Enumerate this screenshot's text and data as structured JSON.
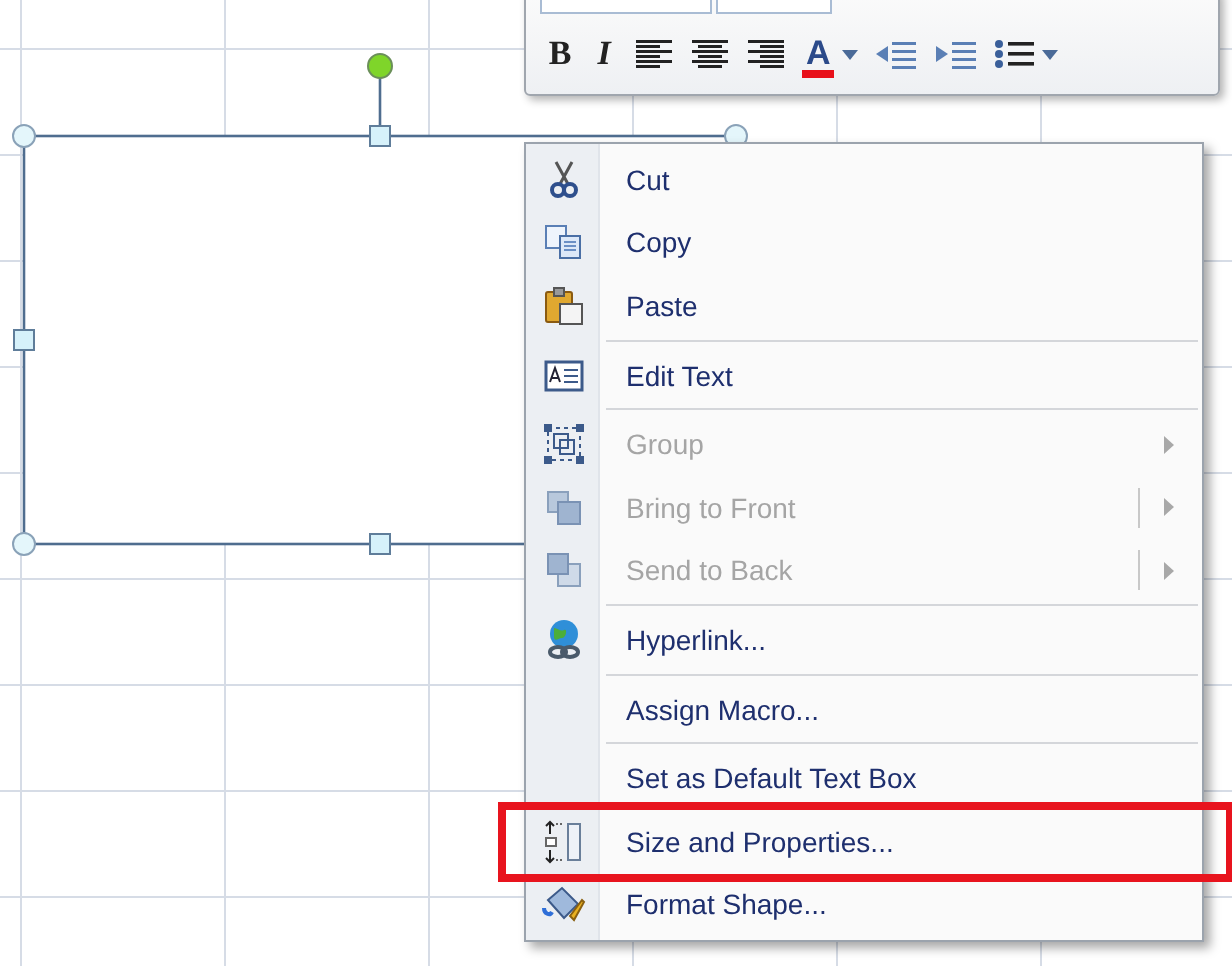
{
  "shape": {
    "selected": true
  },
  "mini_toolbar": {
    "buttons": [
      {
        "kind": "bold",
        "label": "B"
      },
      {
        "kind": "italic",
        "label": "I"
      },
      {
        "kind": "align-left"
      },
      {
        "kind": "align-center"
      },
      {
        "kind": "align-right"
      },
      {
        "kind": "font-color",
        "label": "A",
        "color": "#e8101a"
      },
      {
        "kind": "dropdown"
      },
      {
        "kind": "indent-decrease"
      },
      {
        "kind": "indent-increase"
      },
      {
        "kind": "bullets"
      },
      {
        "kind": "dropdown"
      }
    ]
  },
  "context_menu": {
    "groups": [
      [
        {
          "label": "Cut",
          "disabled": false
        },
        {
          "label": "Copy",
          "disabled": false
        },
        {
          "label": "Paste",
          "disabled": false
        }
      ],
      [
        {
          "label": "Edit Text",
          "disabled": false
        }
      ],
      [
        {
          "label": "Group",
          "disabled": true,
          "submenu": true,
          "split": false
        },
        {
          "label": "Bring to Front",
          "disabled": true,
          "submenu": true,
          "split": true
        },
        {
          "label": "Send to Back",
          "disabled": true,
          "submenu": true,
          "split": true
        }
      ],
      [
        {
          "label": "Hyperlink...",
          "disabled": false
        }
      ],
      [
        {
          "label": "Assign Macro...",
          "disabled": false
        }
      ],
      [
        {
          "label": "Set as Default Text Box",
          "disabled": false
        },
        {
          "label": "Size and Properties...",
          "disabled": false,
          "highlighted": true
        },
        {
          "label": "Format Shape...",
          "disabled": false
        }
      ]
    ]
  }
}
